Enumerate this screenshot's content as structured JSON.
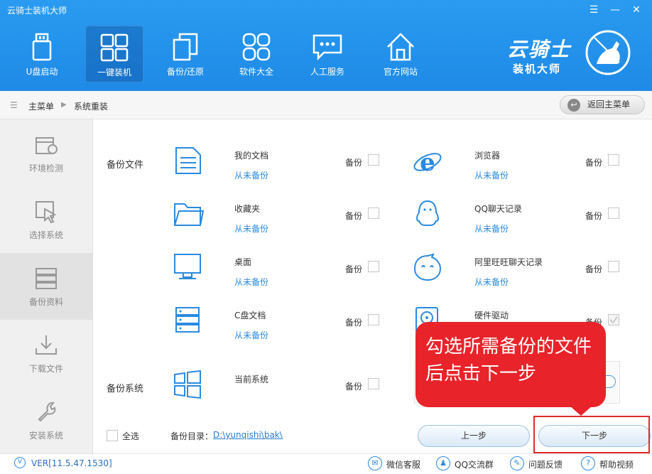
{
  "window": {
    "title": "云骑士装机大师"
  },
  "nav": [
    {
      "label": "U盘启动",
      "icon": "usb-icon"
    },
    {
      "label": "一键装机",
      "icon": "windows-icon"
    },
    {
      "label": "备份/还原",
      "icon": "copy-icon"
    },
    {
      "label": "软件大全",
      "icon": "apps-icon"
    },
    {
      "label": "人工服务",
      "icon": "chat-icon"
    },
    {
      "label": "官方网站",
      "icon": "home-icon"
    }
  ],
  "brand": {
    "name": "云骑士",
    "subtitle": "装机大师"
  },
  "breadcrumb": {
    "root": "主菜单",
    "current": "系统重装"
  },
  "back_button": "返回主菜单",
  "sidebar": [
    {
      "label": "环境检测",
      "icon": "toolbox-icon"
    },
    {
      "label": "选择系统",
      "icon": "cursor-icon"
    },
    {
      "label": "备份资料",
      "icon": "server-icon"
    },
    {
      "label": "下载文件",
      "icon": "download-icon"
    },
    {
      "label": "安装系统",
      "icon": "wrench-icon"
    }
  ],
  "sections": {
    "files": "备份文件",
    "system": "备份系统"
  },
  "backup_label": "备份",
  "items": [
    {
      "name": "我的文档",
      "status": "从未备份",
      "icon": "document-icon"
    },
    {
      "name": "浏览器",
      "status": "从未备份",
      "icon": "ie-icon"
    },
    {
      "name": "收藏夹",
      "status": "从未备份",
      "icon": "folder-icon"
    },
    {
      "name": "QQ聊天记录",
      "status": "从未备份",
      "icon": "qq-icon"
    },
    {
      "name": "桌面",
      "status": "从未备份",
      "icon": "monitor-icon"
    },
    {
      "name": "阿里旺旺聊天记录",
      "status": "从未备份",
      "icon": "wangwang-icon"
    },
    {
      "name": "C盘文档",
      "status": "从未备份",
      "icon": "server-icon"
    },
    {
      "name": "硬件驱动",
      "status": "",
      "icon": "disk-icon"
    },
    {
      "name": "当前系统",
      "status": "",
      "icon": "windows-icon"
    }
  ],
  "select_all": "全选",
  "backup_dir": {
    "label": "备份目录：",
    "path": "D:\\yunqishi\\bak\\"
  },
  "buttons": {
    "prev": "上一步",
    "next": "下一步"
  },
  "callout": {
    "line1": "勾选所需备份的文件",
    "line2": "后点击下一步"
  },
  "footer": {
    "version": "VER[11.5.47.1530]",
    "links": [
      "微信客服",
      "QQ交流群",
      "问题反馈",
      "帮助视频"
    ]
  }
}
